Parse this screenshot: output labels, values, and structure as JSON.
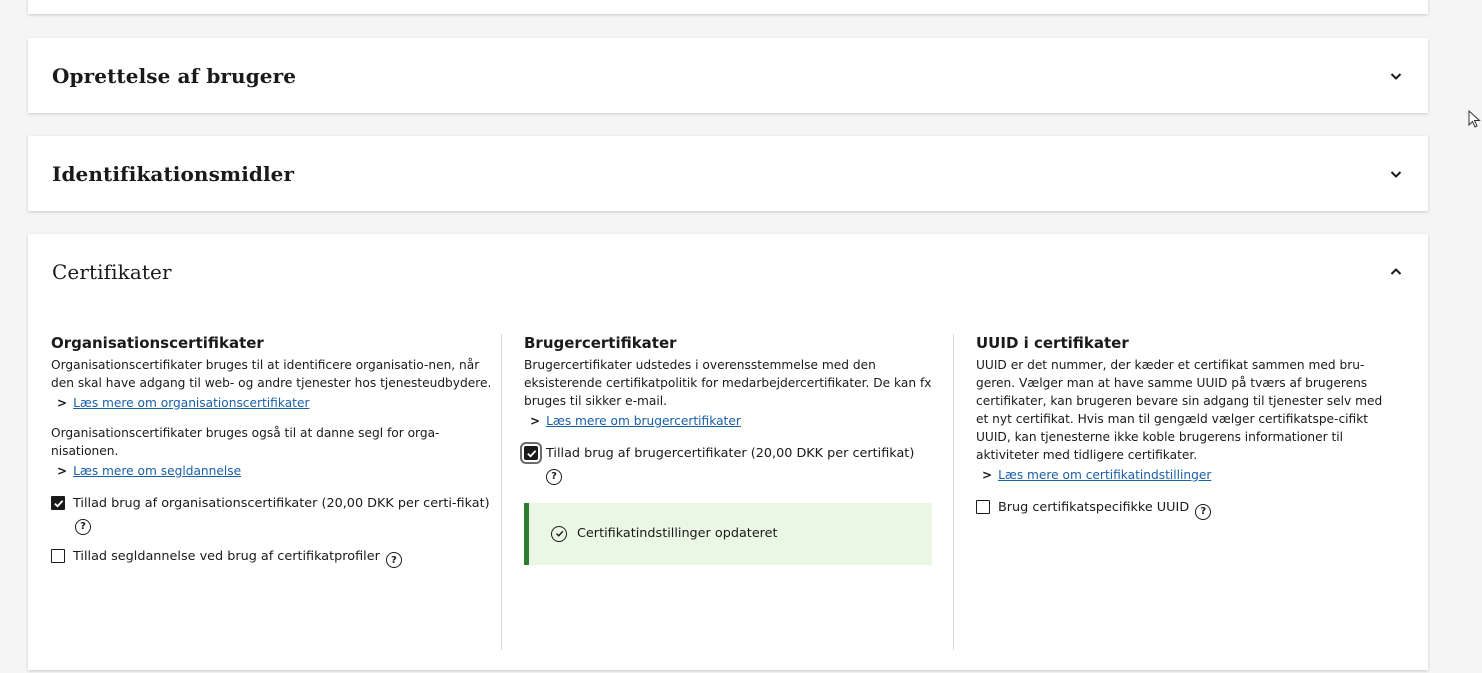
{
  "sections": {
    "opret": {
      "title": "Oprettelse af brugere"
    },
    "ident": {
      "title": "Identifikationsmidler"
    },
    "cert": {
      "title": "Certifikater"
    }
  },
  "org": {
    "heading": "Organisationscertifikater",
    "desc1": "Organisationscertifikater bruges til at identificere organisatio-nen, når den skal have adgang til web- og andre tjenester hos tjenesteudbydere.",
    "link1": "Læs mere om organisationscertifikater",
    "desc2": "Organisationscertifikater bruges også til at danne segl for orga-nisationen.",
    "link2": "Læs mere om segldannelse",
    "check1_label": "Tillad brug af organisationscertifikater (20,00 DKK per certi-fikat)",
    "check1_checked": true,
    "check2_label": "Tillad segldannelse ved brug af certifikatprofiler",
    "check2_checked": false
  },
  "user": {
    "heading": "Brugercertifikater",
    "desc": "Brugercertifikater udstedes i overensstemmelse med den eksisterende certifikatpolitik for medarbejdercertifikater. De kan fx bruges til sikker e-mail.",
    "link": "Læs mere om brugercertifikater",
    "check_label": "Tillad brug af brugercertifikater (20,00 DKK per certifikat)",
    "check_checked": true,
    "alert": "Certifikatindstillinger opdateret"
  },
  "uuid": {
    "heading": "UUID i certifikater",
    "desc": "UUID er det nummer, der kæder et certifikat sammen med bru-geren. Vælger man at have samme UUID på tværs af brugerens certifikater, kan brugeren bevare sin adgang til tjenester selv med et nyt certifikat. Hvis man til gengæld vælger certifikatspe-cifikt UUID, kan tjenesterne ikke koble brugerens informationer til aktiviteter med tidligere certifikater.",
    "link": "Læs mere om certifikatindstillinger",
    "check_label": "Brug certifikatspecifikke UUID",
    "check_checked": false
  },
  "icons": {
    "help": "?",
    "arrow": "›"
  },
  "colors": {
    "link": "#1a5fa8",
    "success_bg": "#e9f7e4",
    "success_border": "#2e7d2e"
  }
}
